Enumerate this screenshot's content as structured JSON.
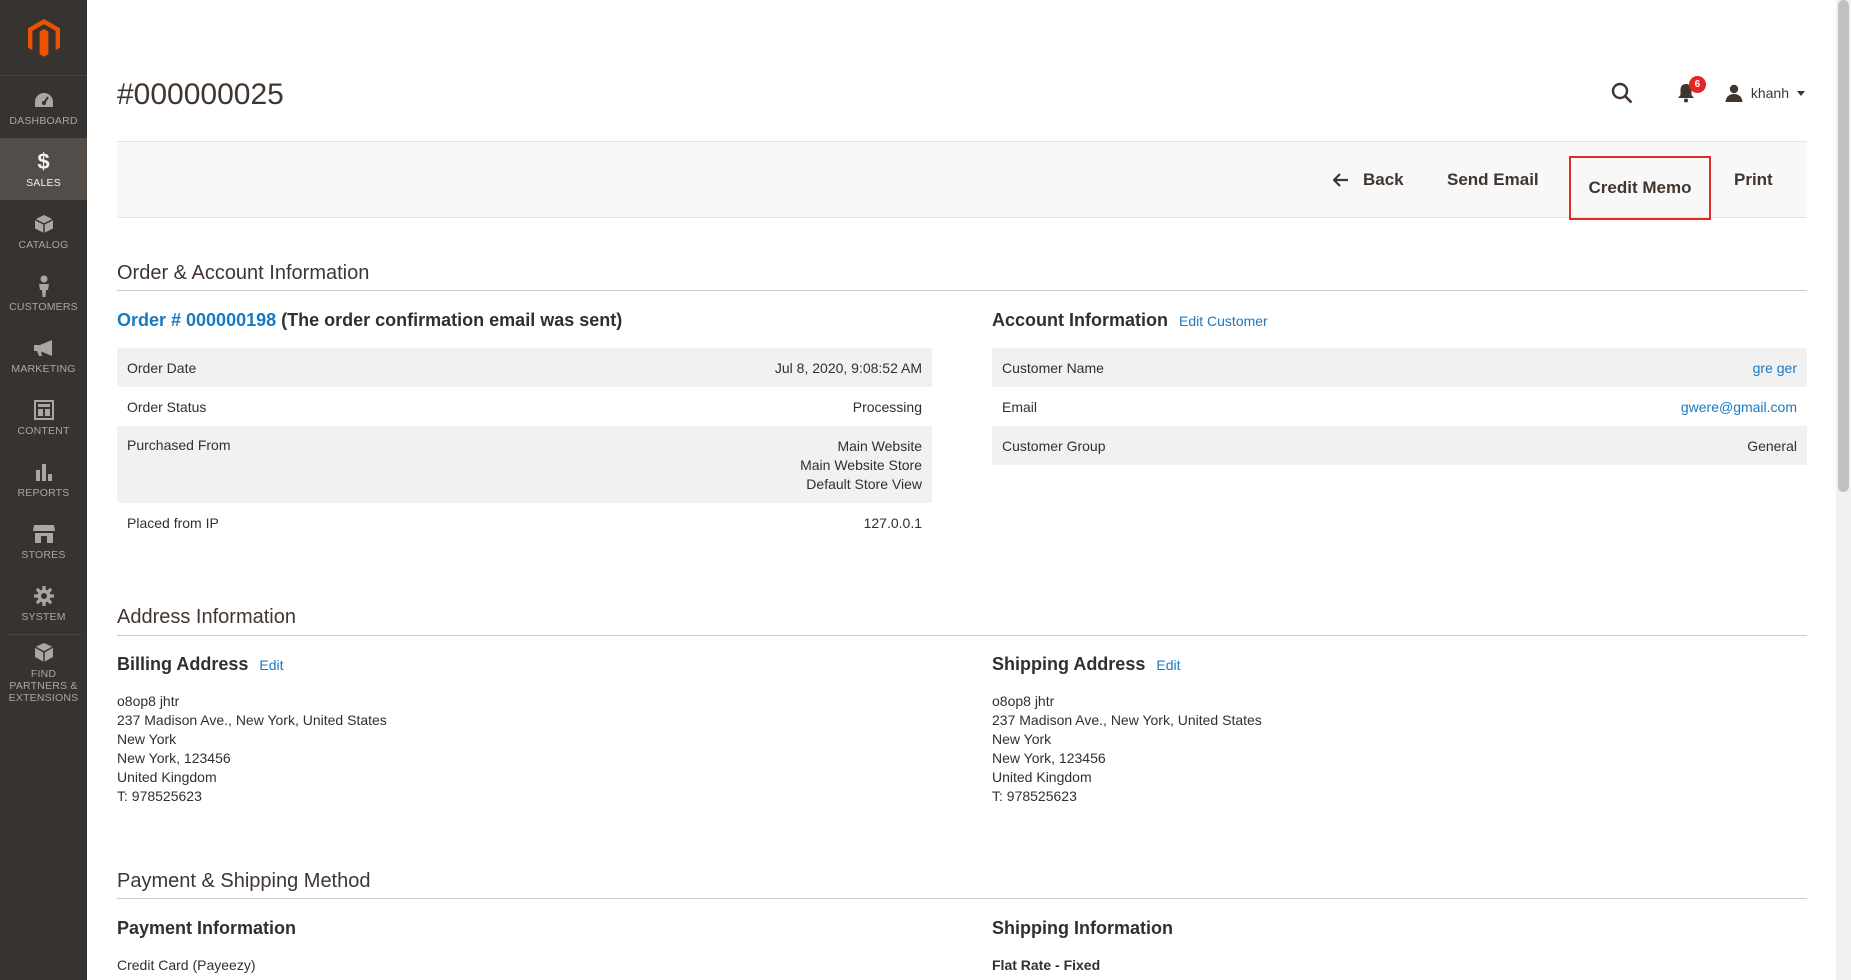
{
  "nav": {
    "items": [
      {
        "label": "DASHBOARD"
      },
      {
        "label": "SALES"
      },
      {
        "label": "CATALOG"
      },
      {
        "label": "CUSTOMERS"
      },
      {
        "label": "MARKETING"
      },
      {
        "label": "CONTENT"
      },
      {
        "label": "REPORTS"
      },
      {
        "label": "STORES"
      },
      {
        "label": "SYSTEM"
      },
      {
        "label": "FIND PARTNERS & EXTENSIONS"
      }
    ]
  },
  "header": {
    "title": "#000000025",
    "notification_count": "6",
    "user": "khanh"
  },
  "actions": {
    "back": "Back",
    "send_email": "Send Email",
    "credit_memo": "Credit Memo",
    "print": "Print"
  },
  "order_account": {
    "section_title": "Order & Account Information",
    "order_link": "Order # 000000198",
    "order_note": "(The order confirmation email was sent)",
    "order_rows": [
      {
        "label": "Order Date",
        "value": "Jul 8, 2020, 9:08:52 AM"
      },
      {
        "label": "Order Status",
        "value": "Processing"
      },
      {
        "label": "Purchased From",
        "value_lines": [
          "Main Website",
          "Main Website Store",
          "Default Store View"
        ]
      },
      {
        "label": "Placed from IP",
        "value": "127.0.0.1"
      }
    ],
    "account_title": "Account Information",
    "edit_customer": "Edit Customer",
    "account_rows": [
      {
        "label": "Customer Name",
        "value": "gre ger"
      },
      {
        "label": "Email",
        "value": "gwere@gmail.com"
      },
      {
        "label": "Customer Group",
        "value": "General"
      }
    ]
  },
  "address": {
    "section_title": "Address Information",
    "billing_title": "Billing Address",
    "shipping_title": "Shipping Address",
    "edit_label": "Edit",
    "billing_lines": [
      "o8op8 jhtr",
      "237 Madison Ave., New York, United States",
      "New York",
      "New York, 123456",
      "United Kingdom",
      "T: 978525623"
    ],
    "shipping_lines": [
      "o8op8 jhtr",
      "237 Madison Ave., New York, United States",
      "New York",
      "New York, 123456",
      "United Kingdom",
      "T: 978525623"
    ]
  },
  "payment_shipping": {
    "section_title": "Payment & Shipping Method",
    "payment_title": "Payment Information",
    "payment_method": "Credit Card (Payeezy)",
    "shipping_title": "Shipping Information",
    "shipping_method": "Flat Rate - Fixed"
  },
  "colors": {
    "nav_bg": "#373330",
    "link": "#1979c3",
    "highlight": "#e02b27",
    "logo": "#eb5202"
  }
}
